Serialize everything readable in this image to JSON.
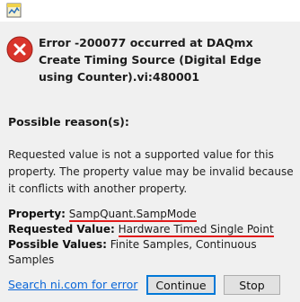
{
  "dialog": {
    "headline": "Error -200077 occurred at DAQmx Create Timing Source (Digital Edge using Counter).vi:480001",
    "reason_title": "Possible reason(s):",
    "reason_text": "Requested value is not a supported value for this property. The property value may be invalid because it conflicts with another property.",
    "property_label": "Property:",
    "property_value": "SampQuant.SampMode",
    "requested_label": "Requested Value:",
    "requested_value": "Hardware Timed Single Point",
    "possible_label": "Possible Values:",
    "possible_value": "Finite Samples, Continuous Samples"
  },
  "footer": {
    "search_link": "Search ni.com for error",
    "continue_label": "Continue",
    "stop_label": "Stop"
  },
  "icons": {
    "app": "labview-app-icon",
    "error": "error-icon"
  },
  "colors": {
    "error_red": "#d9342b",
    "link_blue": "#0a66d8",
    "annotation_red": "#e21a1a",
    "focus_border": "#0078d7"
  }
}
